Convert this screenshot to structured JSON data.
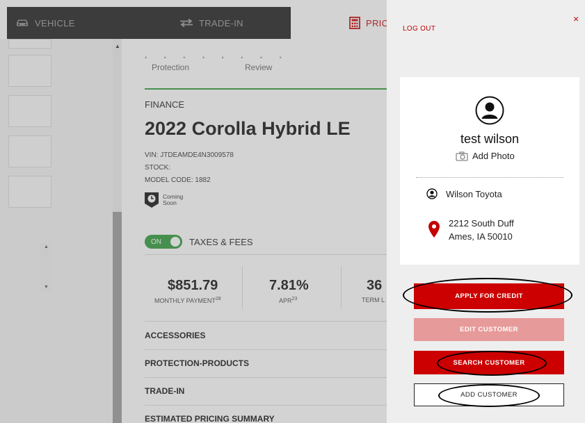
{
  "nav": {
    "tabs": [
      {
        "label": "VEHICLE",
        "icon": "car-icon"
      },
      {
        "label": "TRADE-IN",
        "icon": "swap-arrows-icon"
      },
      {
        "label": "PRIC",
        "icon": "calculator-icon"
      }
    ]
  },
  "progress": {
    "steps": [
      "Protection",
      "Review"
    ]
  },
  "vehicle": {
    "section_label": "FINANCE",
    "title": "2022 Corolla Hybrid LE",
    "vin": "VIN: JTDEAMDE4N3009578",
    "stock": "STOCK:",
    "model_code": "MODEL CODE: 1882",
    "badge_line1": "Coming",
    "badge_line2": "Soon"
  },
  "taxes_toggle": {
    "state": "ON",
    "label": "TAXES & FEES"
  },
  "stats": [
    {
      "value": "$851.79",
      "label": "MONTHLY PAYMENT",
      "sup": "28"
    },
    {
      "value": "7.81%",
      "label": "APR",
      "sup": "23"
    },
    {
      "value": "36",
      "label": "TERM L",
      "sup": ""
    }
  ],
  "sections": [
    "ACCESSORIES",
    "PROTECTION-PRODUCTS",
    "TRADE-IN",
    "ESTIMATED PRICING SUMMARY"
  ],
  "drawer": {
    "close": "×",
    "logout": "LOG OUT",
    "customer_name": "test wilson",
    "add_photo": "Add Photo",
    "dealer": "Wilson Toyota",
    "address_line1": "2212 South Duff",
    "address_line2": "Ames, IA 50010",
    "buttons": {
      "apply": "APPLY FOR CREDIT",
      "edit": "EDIT CUSTOMER",
      "search": "SEARCH CUSTOMER",
      "add": "ADD CUSTOMER"
    }
  },
  "colors": {
    "brand_red": "#cc0000",
    "disabled_red": "#e79a9a",
    "success_green": "#2e9a3a",
    "nav_dark": "#1f1f1f"
  }
}
